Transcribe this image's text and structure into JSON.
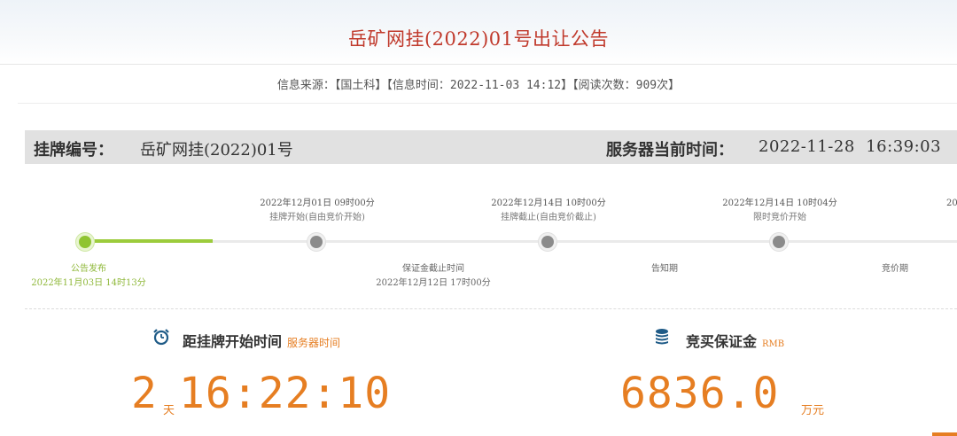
{
  "page": {
    "title": "岳矿网挂(2022)01号出让公告"
  },
  "meta": {
    "source": "信息来源：【国土科】【信息时间：2022-11-03 14:12】【阅读次数：909次】"
  },
  "infobar": {
    "label": "挂牌编号：",
    "number": "岳矿网挂(2022)01号",
    "time_label": "服务器当前时间：",
    "time_value": "2022-11-28  16:39:03"
  },
  "timeline": {
    "top": [
      {
        "date": "2022年12月01日 09时00分",
        "name": "挂牌开始(自由竞价开始)"
      },
      {
        "date": "2022年12月14日 10时00分",
        "name": "挂牌截止(自由竞价截止)"
      },
      {
        "date": "2022年12月14日 10时04分",
        "name": "限时竞价开始"
      },
      {
        "date": "20"
      }
    ],
    "bottom": [
      {
        "name": "公告发布",
        "date": "2022年11月03日 14时13分"
      },
      {
        "name": "保证金截止时间",
        "date": "2022年12月12日 17时00分"
      },
      {
        "name": "告知期"
      },
      {
        "name": "竞价期"
      }
    ],
    "progress_fraction": 0.15
  },
  "countdown": {
    "heading": "距挂牌开始时间",
    "heading_sub": "服务器时间",
    "days": "2",
    "days_unit": "天",
    "time": "16:22:10"
  },
  "deposit": {
    "heading": "竞买保证金",
    "heading_sub": "RMB",
    "amount": "6836.0",
    "unit": "万元"
  },
  "colors": {
    "title": "#c0392b",
    "accent": "#e67e22",
    "progress": "#8fc431"
  },
  "icons": {
    "countdown": "alarm-clock-icon",
    "deposit": "coin-stack-icon"
  }
}
